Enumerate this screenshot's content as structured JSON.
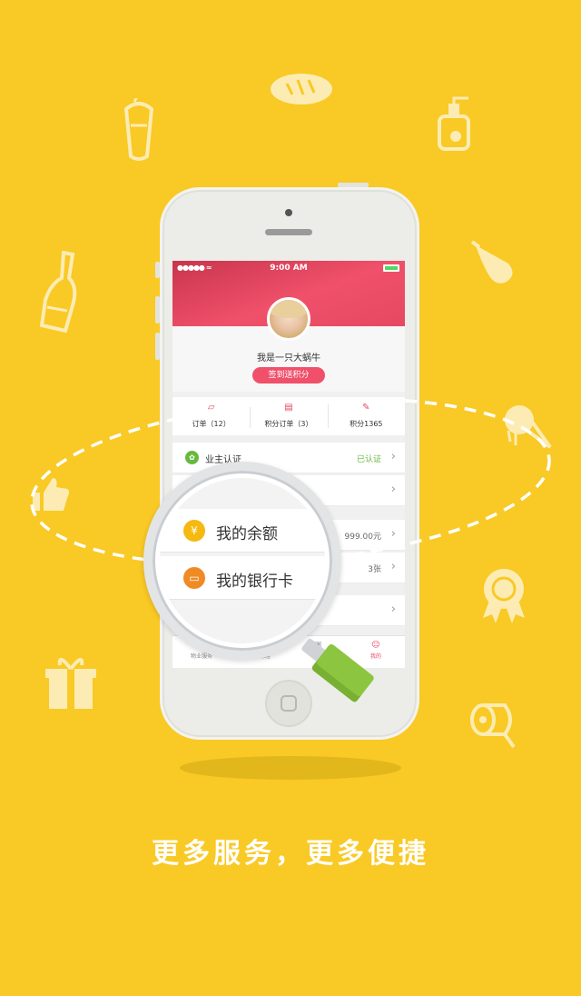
{
  "status_bar": {
    "signal": "●●●●● ≈",
    "time": "9:00 AM"
  },
  "profile": {
    "nickname": "我是一只大蜗牛",
    "signin_label": "签到送积分"
  },
  "stats": [
    {
      "icon": "order-icon",
      "label": "订单（12）"
    },
    {
      "icon": "points-order-icon",
      "label": "积分订单（3）"
    },
    {
      "icon": "points-icon",
      "label": "积分1365"
    }
  ],
  "rows": [
    {
      "label": "业主认证",
      "value": "已认证",
      "icon": "owner-icon"
    },
    {
      "label": "",
      "value": ""
    },
    {
      "label": "",
      "value": "999.00元"
    },
    {
      "label": "",
      "value": "3张"
    },
    {
      "label": "",
      "value": ""
    }
  ],
  "magnifier": {
    "balance_label": "我的余额",
    "bankcard_label": "我的银行卡",
    "balance_icon": "¥"
  },
  "tabbar": [
    {
      "label": "物业服务",
      "icon": "house-icon"
    },
    {
      "label": "生活助理",
      "icon": "assistant-icon"
    },
    {
      "label": "商城",
      "icon": "mall-icon"
    },
    {
      "label": "我的",
      "icon": "me-icon"
    }
  ],
  "tagline": "更多服务，更多便捷",
  "colors": {
    "background": "#F9C925",
    "accent": "#F0506A",
    "verified": "#67B93E",
    "handle": "#8CC53F"
  }
}
